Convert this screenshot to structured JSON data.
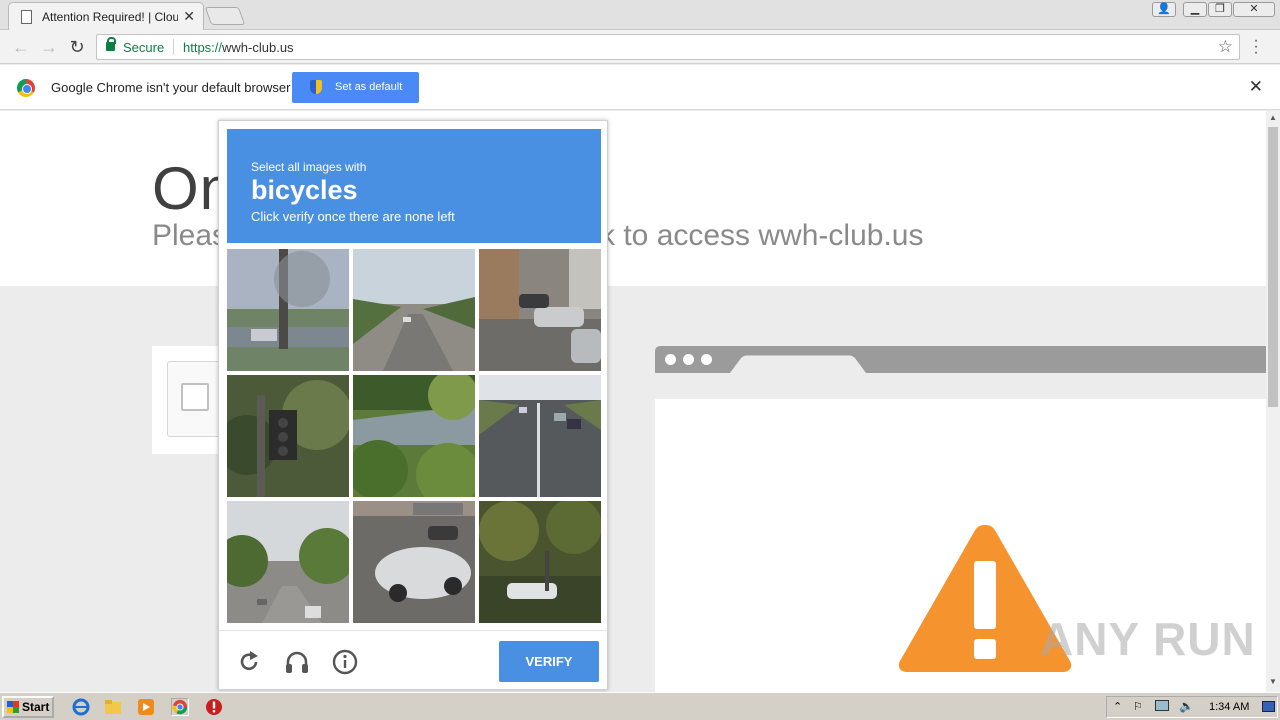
{
  "browser": {
    "tab_title": "Attention Required! | Cloudf",
    "tab_close": "✕",
    "back": "←",
    "forward": "→",
    "reload": "↻",
    "secure_label": "Secure",
    "url_scheme": "https://",
    "url_host": "wwh-club.us",
    "star": "☆",
    "win_user": "👤",
    "win_min": "▁",
    "win_max": "❐",
    "win_close": "✕"
  },
  "infobar": {
    "message": "Google Chrome isn't your default browser",
    "button_label": "Set as default",
    "close": "✕"
  },
  "page": {
    "heading_fragment": "On",
    "subtitle_left": "Pleas",
    "subtitle_right": "k to access wwh-club.us"
  },
  "captcha": {
    "instruction": "Select all images with",
    "target": "bicycles",
    "hint": "Click verify once there are none left",
    "verify_label": "VERIFY",
    "tile_count": 9
  },
  "watermark": "ANY RUN",
  "taskbar": {
    "start_label": "Start",
    "clock": "1:34 AM"
  },
  "colors": {
    "captcha_blue": "#4a90e2",
    "secure_green": "#0b8043",
    "warning_orange": "#f5932f",
    "infobar_button": "#4a8af4"
  }
}
